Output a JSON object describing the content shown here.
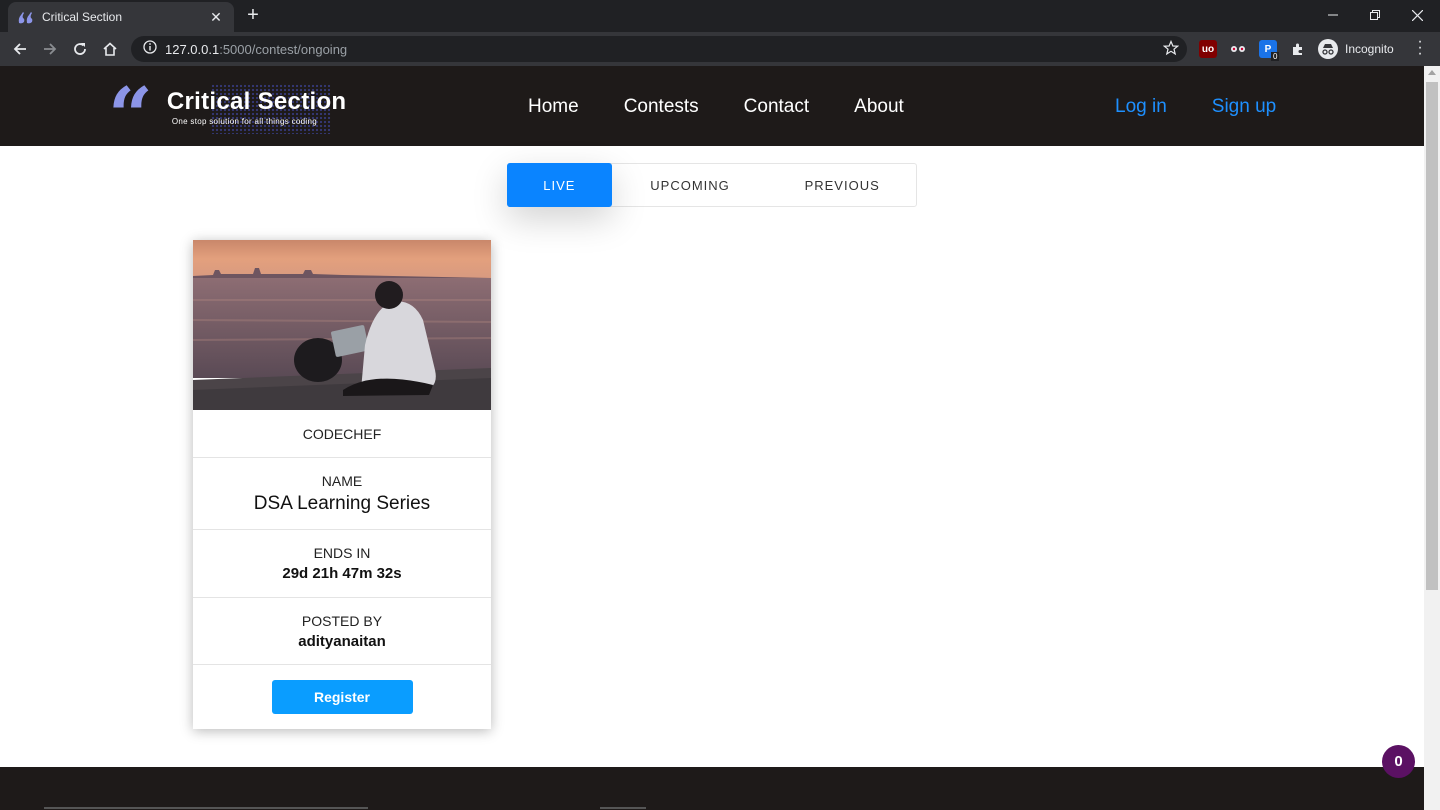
{
  "browser": {
    "tab_title": "Critical Section",
    "url_host": "127.0.0.1",
    "url_path": ":5000/contest/ongoing",
    "incognito_label": "Incognito",
    "ext_badge": "0",
    "icons": [
      "back-icon",
      "forward-icon",
      "reload-icon",
      "home-icon",
      "info-icon",
      "star-icon",
      "extensions-icon",
      "menu-icon"
    ]
  },
  "site": {
    "brand_title": "Critical Section",
    "brand_tagline": "One stop solution for all things coding",
    "nav": [
      "Home",
      "Contests",
      "Contact",
      "About"
    ],
    "auth": {
      "login": "Log in",
      "signup": "Sign up"
    },
    "accent_color": "#0a84ff"
  },
  "tabs": {
    "live": "LIVE",
    "upcoming": "UPCOMING",
    "previous": "PREVIOUS",
    "active": "live"
  },
  "contest_card": {
    "platform": "CODECHEF",
    "name_label": "NAME",
    "name": "DSA Learning Series",
    "ends_label": "ENDS IN",
    "ends_in": "29d 21h 47m 32s",
    "posted_label": "POSTED BY",
    "posted_by": "adityanaitan",
    "register_label": "Register"
  },
  "chat_badge": "0"
}
